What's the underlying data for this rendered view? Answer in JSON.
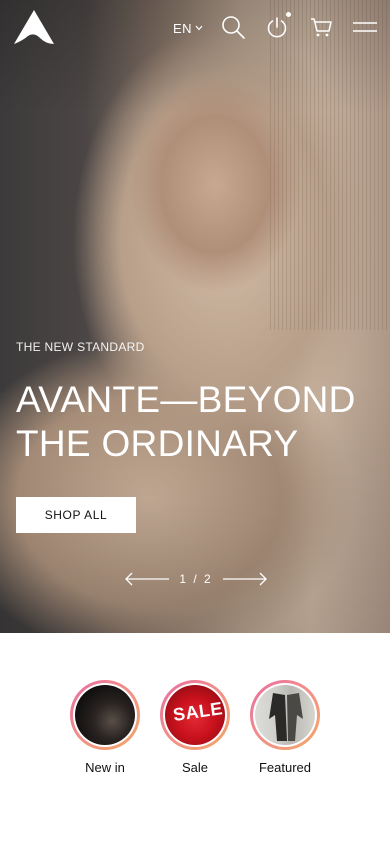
{
  "header": {
    "language": "EN",
    "icons": [
      "logo-icon",
      "chevron-down-icon",
      "search-icon",
      "power-icon",
      "cart-icon",
      "menu-icon"
    ]
  },
  "hero": {
    "kicker": "THE NEW STANDARD",
    "headline_line1": "AVANTE—BEYOND",
    "headline_line2": "THE ORDINARY",
    "cta_label": "SHOP ALL",
    "slide_indicator": "1 / 2",
    "current_slide": 1,
    "total_slides": 2
  },
  "categories": [
    {
      "label": "New in"
    },
    {
      "label": "Sale",
      "thumb_text": "SALE"
    },
    {
      "label": "Featured"
    }
  ],
  "colors": {
    "ring_gradient_start": "#e86aa0",
    "ring_gradient_end": "#f4a866",
    "button_bg": "#ffffff",
    "text_on_hero": "#ffffff"
  }
}
